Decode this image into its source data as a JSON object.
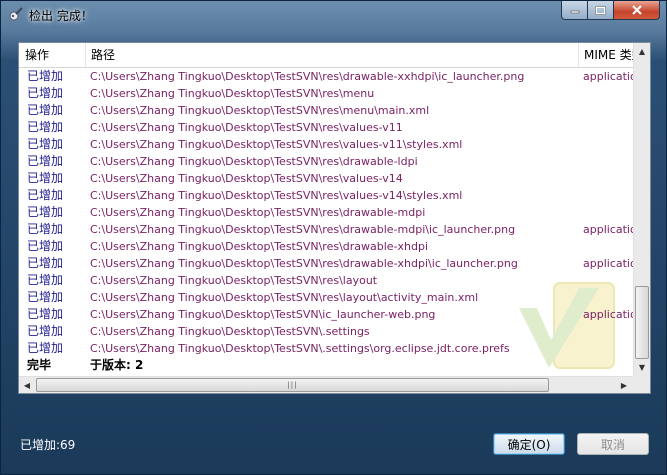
{
  "window": {
    "title": "检出 完成！"
  },
  "table": {
    "columns": [
      "操作",
      "路径",
      "MIME 类型"
    ],
    "rows": [
      {
        "action": "已增加",
        "path": "C:\\Users\\Zhang Tingkuo\\Desktop\\TestSVN\\res\\drawable-xxhdpi\\ic_launcher.png",
        "mime": "application"
      },
      {
        "action": "已增加",
        "path": "C:\\Users\\Zhang Tingkuo\\Desktop\\TestSVN\\res\\menu",
        "mime": ""
      },
      {
        "action": "已增加",
        "path": "C:\\Users\\Zhang Tingkuo\\Desktop\\TestSVN\\res\\menu\\main.xml",
        "mime": ""
      },
      {
        "action": "已增加",
        "path": "C:\\Users\\Zhang Tingkuo\\Desktop\\TestSVN\\res\\values-v11",
        "mime": ""
      },
      {
        "action": "已增加",
        "path": "C:\\Users\\Zhang Tingkuo\\Desktop\\TestSVN\\res\\values-v11\\styles.xml",
        "mime": ""
      },
      {
        "action": "已增加",
        "path": "C:\\Users\\Zhang Tingkuo\\Desktop\\TestSVN\\res\\drawable-ldpi",
        "mime": ""
      },
      {
        "action": "已增加",
        "path": "C:\\Users\\Zhang Tingkuo\\Desktop\\TestSVN\\res\\values-v14",
        "mime": ""
      },
      {
        "action": "已增加",
        "path": "C:\\Users\\Zhang Tingkuo\\Desktop\\TestSVN\\res\\values-v14\\styles.xml",
        "mime": ""
      },
      {
        "action": "已增加",
        "path": "C:\\Users\\Zhang Tingkuo\\Desktop\\TestSVN\\res\\drawable-mdpi",
        "mime": ""
      },
      {
        "action": "已增加",
        "path": "C:\\Users\\Zhang Tingkuo\\Desktop\\TestSVN\\res\\drawable-mdpi\\ic_launcher.png",
        "mime": "application"
      },
      {
        "action": "已增加",
        "path": "C:\\Users\\Zhang Tingkuo\\Desktop\\TestSVN\\res\\drawable-xhdpi",
        "mime": ""
      },
      {
        "action": "已增加",
        "path": "C:\\Users\\Zhang Tingkuo\\Desktop\\TestSVN\\res\\drawable-xhdpi\\ic_launcher.png",
        "mime": "application"
      },
      {
        "action": "已增加",
        "path": "C:\\Users\\Zhang Tingkuo\\Desktop\\TestSVN\\res\\layout",
        "mime": ""
      },
      {
        "action": "已增加",
        "path": "C:\\Users\\Zhang Tingkuo\\Desktop\\TestSVN\\res\\layout\\activity_main.xml",
        "mime": ""
      },
      {
        "action": "已增加",
        "path": "C:\\Users\\Zhang Tingkuo\\Desktop\\TestSVN\\ic_launcher-web.png",
        "mime": "application"
      },
      {
        "action": "已增加",
        "path": "C:\\Users\\Zhang Tingkuo\\Desktop\\TestSVN\\.settings",
        "mime": ""
      },
      {
        "action": "已增加",
        "path": "C:\\Users\\Zhang Tingkuo\\Desktop\\TestSVN\\.settings\\org.eclipse.jdt.core.prefs",
        "mime": ""
      }
    ],
    "final_row": {
      "action": "完毕",
      "path": "于版本: 2"
    }
  },
  "status": {
    "text": "已增加:69"
  },
  "buttons": {
    "ok": "确定(O)",
    "cancel": "取消"
  },
  "colors": {
    "action_text": "#1d1d8e",
    "path_text": "#7a2265"
  }
}
